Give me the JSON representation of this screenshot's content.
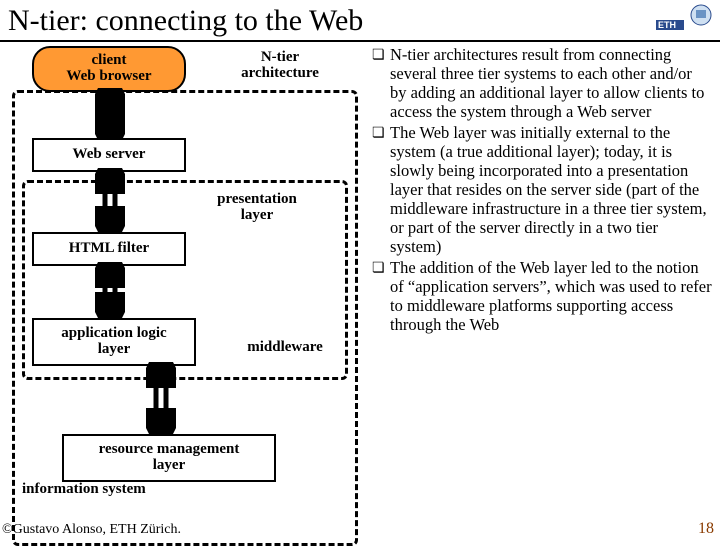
{
  "title": "N-tier: connecting to the Web",
  "diagram": {
    "client": {
      "line1": "client",
      "line2": "Web browser"
    },
    "ntier": "N-tier\narchitecture",
    "webserver": "Web server",
    "presentation": "presentation\nlayer",
    "htmlfilter": "HTML filter",
    "applogic": "application logic\nlayer",
    "middleware": "middleware",
    "resource": "resource management\nlayer",
    "infosys": "information system"
  },
  "bullets": [
    "N-tier architectures result from connecting several three tier systems to each other and/or by adding an additional layer to allow clients to access the system through a Web server",
    "The Web layer was initially external to the system (a true additional layer); today, it is slowly being incorporated into a presentation layer that resides on the server side (part of the middleware infrastructure in a three tier system, or part of the server directly in a two tier system)",
    "The addition of the Web layer led to the notion of “application servers”, which was used to refer to middleware platforms supporting access through the Web"
  ],
  "footer": "©Gustavo Alonso, ETH Zürich.",
  "page": "18"
}
